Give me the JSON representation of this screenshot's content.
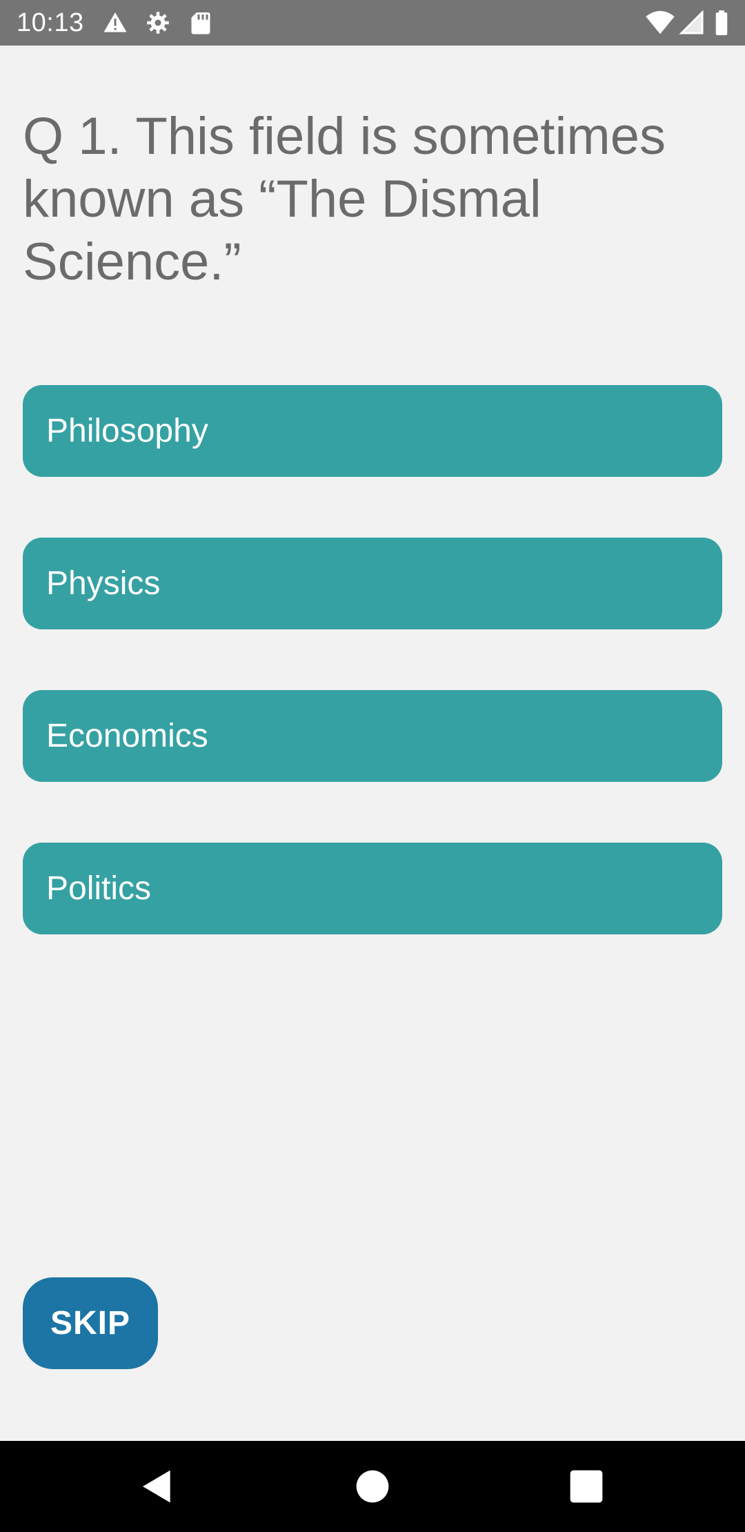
{
  "status_bar": {
    "time": "10:13",
    "left_icons": [
      "warning-icon",
      "gear-icon",
      "sd-card-icon"
    ],
    "right_icons": [
      "wifi-icon",
      "signal-icon",
      "battery-icon"
    ]
  },
  "quiz": {
    "question": "Q 1. This field is sometimes known as “The Dismal Science.”",
    "answers": [
      "Philosophy",
      "Physics",
      "Economics",
      "Politics"
    ],
    "skip_label": "SKIP"
  },
  "nav_bar": {
    "buttons": [
      "back-icon",
      "home-icon",
      "recents-icon"
    ]
  },
  "colors": {
    "status_bar": "#757575",
    "background": "#f2f2f2",
    "answer_button": "#35a1a3",
    "skip_button": "#1c75a4",
    "question_text": "#6b6b6b",
    "nav_bar": "#000000"
  }
}
